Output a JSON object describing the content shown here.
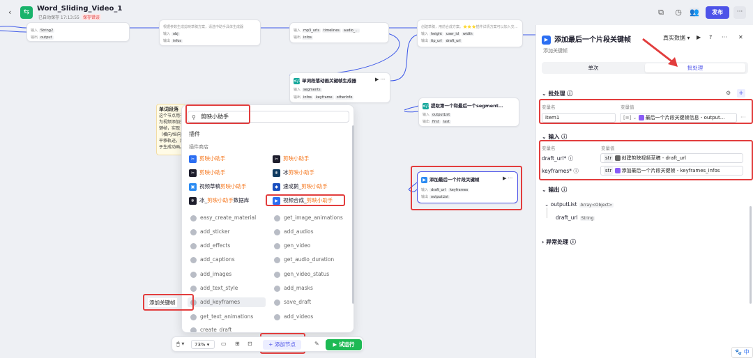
{
  "header": {
    "title": "Word_Sliding_Video_1",
    "autosave": "已自动保存 17:13:55",
    "badge": "保存错误",
    "publish": "发布",
    "more": "···"
  },
  "nodes": {
    "n1": {
      "in_label": "输入",
      "in_chip": "String2",
      "out_label": "输出",
      "out_chip": "output"
    },
    "n2": {
      "desc": "根据参数生成剪映草稿方案，请选中助手具体生成器",
      "r1_label": "输入",
      "r1_chip": "obj",
      "r2_label": "输出",
      "r2_chip": "infos"
    },
    "n3": {
      "r1_label": "输入",
      "r1a": "mp3_urls",
      "r1b": "timelines",
      "r1c": "audio_...",
      "r2_label": "输出",
      "r2a": "infos"
    },
    "n4": {
      "desc": "创建草稿，用前合成方案。⭐⭐⭐插件详情方案可以加入交…",
      "r1_label": "输入",
      "r1a": "height",
      "r1b": "user_id",
      "r1c": "width",
      "r2_label": "输出",
      "r2a": "tip_url",
      "r2b": "draft_url"
    },
    "n5": {
      "title": "单词段落动画关键帧生成器",
      "r1_label": "输入",
      "r1a": "segments",
      "r2_label": "输出",
      "r2a": "infos",
      "r2b": "keyframe",
      "r2c": "otherInfo"
    },
    "n6": {
      "title": "提取第一个和最后一个segment…",
      "r1_label": "输入",
      "r1a": "outputList",
      "r2_label": "输出",
      "r2a": "first",
      "r2b": "last"
    },
    "n7": {
      "title": "添加最后一个片段关键帧",
      "r1_label": "输入",
      "r1a": "draft_url",
      "r1b": "keyframes",
      "r2_label": "输出",
      "r2a": "outputList"
    }
  },
  "tooltip": {
    "title": "单词段落",
    "body": "这个节点用于为视频添加关键帧，实现（横向/纵向）平移轨迹，用于生成动画。"
  },
  "popup": {
    "search_value": "剪映小助手",
    "section_plugin": "插件",
    "section_store": "插件商店",
    "plugins": [
      {
        "label": "剪映小助手",
        "color": "#2b6ef2"
      },
      {
        "label": "剪映小助手",
        "color": "#1d1d2c"
      },
      {
        "label": "剪映小助手",
        "color": "#1d1d2c"
      },
      {
        "prefix": "冰",
        "label": "剪映小助手",
        "color": "#0f3a5f"
      },
      {
        "prefix": "视频草稿",
        "label": "剪映小助手",
        "color": "#2b8bf2"
      },
      {
        "prefix": "速成鹅_",
        "label": "剪映小助手",
        "color": "#1a4fbf"
      },
      {
        "prefix": "冰_",
        "label": "剪映小助手",
        "suffix": "数据库",
        "color": "#1d1d2c"
      },
      {
        "prefix": "视频合成_",
        "label": "剪映小助手",
        "color": "#2b6ef2"
      }
    ],
    "tools_left": [
      "easy_create_material",
      "add_sticker",
      "add_effects",
      "add_captions",
      "add_images",
      "add_text_style",
      "add_keyframes",
      "get_text_animations",
      "create_draft"
    ],
    "tools_right": [
      "get_image_animations",
      "add_audios",
      "gen_video",
      "get_audio_duration",
      "gen_video_status",
      "add_masks",
      "save_draft",
      "add_videos"
    ],
    "hover_tip": "添加关键帧"
  },
  "bottombar": {
    "zoom": "73%",
    "add_node": "添加节点",
    "run": "试运行"
  },
  "panel": {
    "title": "添加最后一个片段关键帧",
    "subtitle": "添加关键帧",
    "data_mode": "真实数据",
    "tab_single": "单次",
    "tab_batch": "批处理",
    "batch": {
      "heading": "批处理",
      "col_name": "变量名",
      "col_value": "变量值",
      "var_name": "item1",
      "ref_text": "最后一个片段关键帧信息 - output…"
    },
    "inputs": {
      "heading": "输入",
      "col_name": "变量名",
      "col_value": "变量值",
      "rows": [
        {
          "name": "draft_url*",
          "type": "str",
          "ref_text": "创建剪映视频草稿 - draft_url"
        },
        {
          "name": "keyframes*",
          "type": "str",
          "ref_text": "添加最后一个片段关键帧 - keyframes_infos"
        }
      ]
    },
    "outputs": {
      "heading": "输出",
      "list_name": "outputList",
      "list_type": "Array<Object>",
      "child_name": "draft_url",
      "child_type": "String"
    },
    "error": {
      "heading": "异常处理"
    }
  },
  "fab": "中"
}
